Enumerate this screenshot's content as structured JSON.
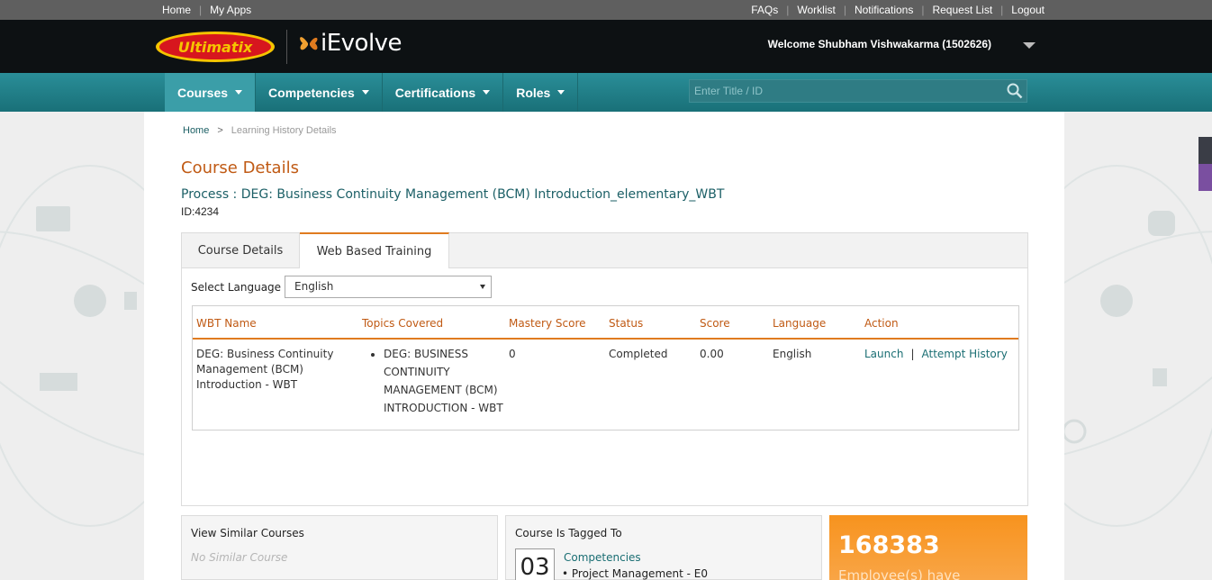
{
  "topbar": {
    "left_links": [
      "Home",
      "My Apps"
    ],
    "right_links": [
      "FAQs",
      "Worklist",
      "Notifications",
      "Request List",
      "Logout"
    ]
  },
  "header": {
    "ultimatix_logo": "Ultimatix",
    "app_name": "iEvolve",
    "welcome": "Welcome Shubham Vishwakarma (1502626)"
  },
  "nav": {
    "items": [
      "Courses",
      "Competencies",
      "Certifications",
      "Roles"
    ],
    "search_placeholder": "Enter Title / ID"
  },
  "breadcrumb": {
    "home": "Home",
    "separator": ">",
    "current": "Learning History Details"
  },
  "course": {
    "section_title": "Course Details",
    "name": "Process : DEG: Business Continuity Management (BCM) Introduction_elementary_WBT",
    "id": "ID:4234"
  },
  "tabs": [
    "Course Details",
    "Web Based Training"
  ],
  "language": {
    "label": "Select Language",
    "selected": "English"
  },
  "wbt_table": {
    "headers": [
      "WBT Name",
      "Topics Covered",
      "Mastery Score",
      "Status",
      "Score",
      "Language",
      "Action"
    ],
    "row": {
      "name_lines": [
        "DEG: Business Continuity",
        "Management (BCM)",
        "Introduction - WBT"
      ],
      "topic_lines": [
        "DEG: BUSINESS",
        "CONTINUITY",
        "MANAGEMENT (BCM)",
        "INTRODUCTION - WBT"
      ],
      "mastery_score": "0",
      "status": "Completed",
      "score": "0.00",
      "language": "English",
      "action_launch": "Launch",
      "action_separator": "|",
      "action_history": "Attempt History"
    }
  },
  "similar": {
    "title": "View Similar Courses",
    "empty": "No Similar Course"
  },
  "tagged": {
    "title": "Course Is Tagged To",
    "count": "03",
    "link": "Competencies",
    "item": "Project Management - E0"
  },
  "stats": {
    "count": "168383",
    "label": "Employee(s) have"
  },
  "colors": {
    "accent_orange": "#e07b1f",
    "title_orange": "#c05a14",
    "teal": "#1b5f66",
    "nav_teal": "#2a8e98"
  }
}
